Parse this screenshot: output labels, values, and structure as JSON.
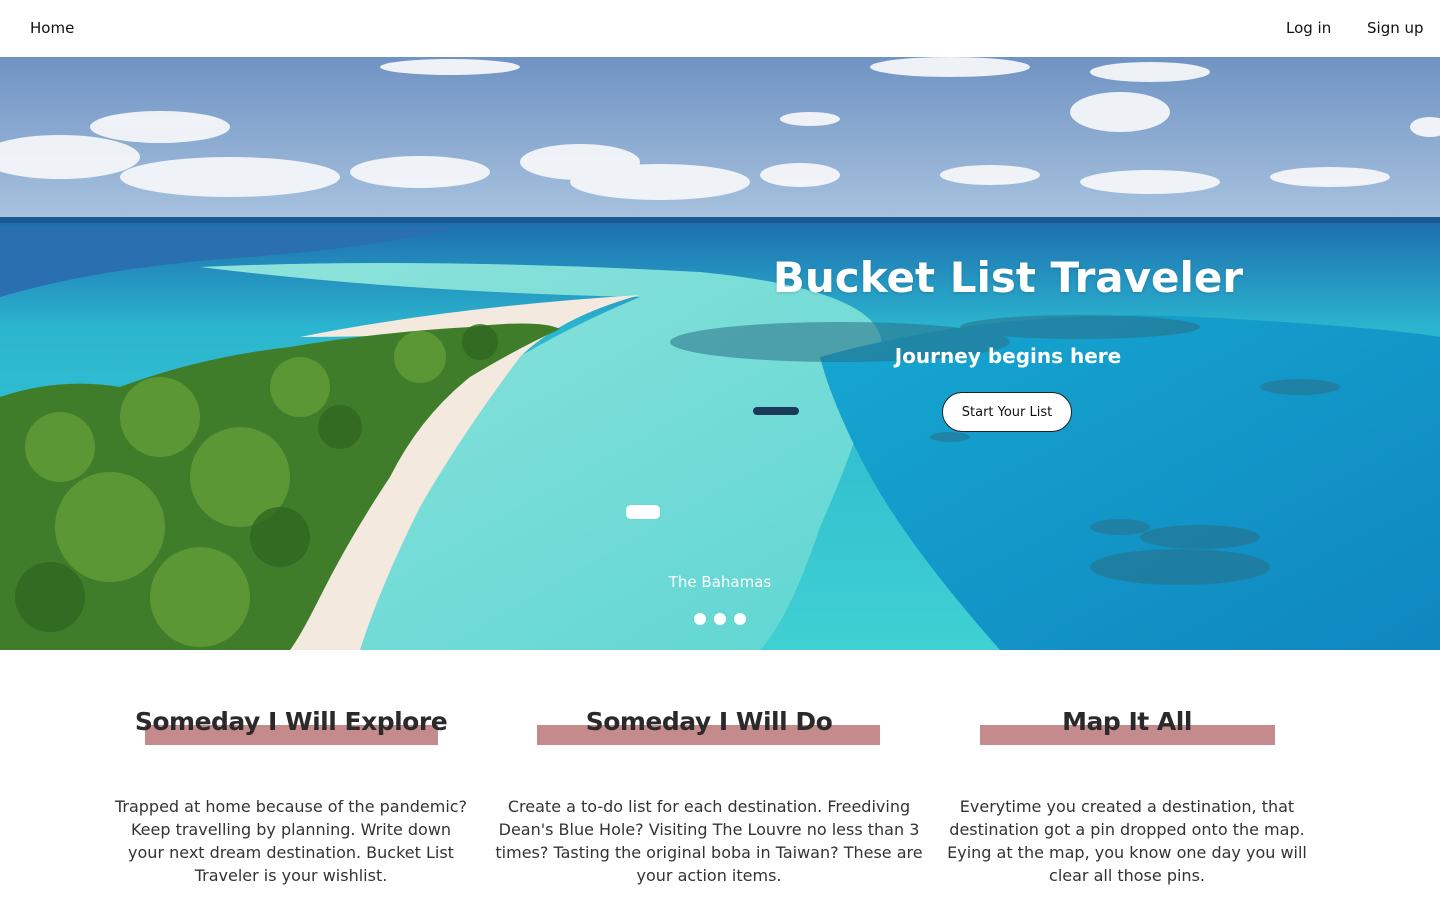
{
  "nav": {
    "home": "Home",
    "login": "Log in",
    "signup": "Sign up"
  },
  "hero": {
    "title": "Bucket List Traveler",
    "subtitle": "Journey begins here",
    "cta": "Start Your List",
    "caption": "The Bahamas",
    "slide_count": 3
  },
  "features": [
    {
      "title": "Someday I Will Explore",
      "text": "Trapped at home because of the pandemic? Keep travelling by planning. Write down your next dream destination. Bucket List Traveler is your wishlist."
    },
    {
      "title": "Someday I Will Do",
      "text": "Create a to-do list for each destination. Freediving Dean's Blue Hole? Visiting The Louvre no less than 3 times? Tasting the original boba in Taiwan? These are your action items."
    },
    {
      "title": "Map It All",
      "text": "Everytime you created a destination, that destination got a pin dropped onto the map. Eying at the map, you know one day you will clear all those pins."
    }
  ],
  "colors": {
    "highlight": "#c48a8c",
    "sky": "#6f93c3",
    "lagoon": "#38c9cf",
    "deep_water": "#1e6fb0",
    "vegetation": "#3f7d2a",
    "sand": "#f3e9df"
  }
}
